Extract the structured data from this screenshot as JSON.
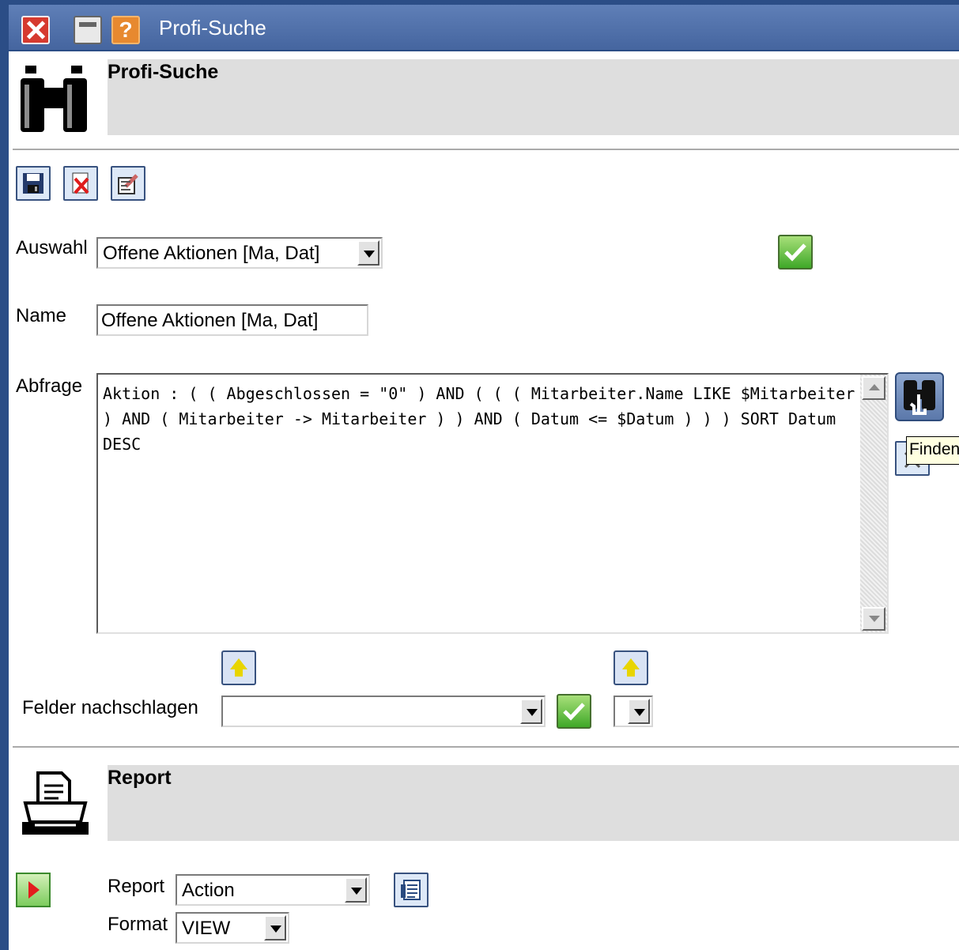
{
  "window": {
    "title": "Profi-Suche"
  },
  "search_section": {
    "heading": "Profi-Suche",
    "icon": "binoculars-icon"
  },
  "toolbar": {
    "save_icon": "save-icon",
    "delete_icon": "delete-icon",
    "edit_icon": "edit-icon"
  },
  "form": {
    "auswahl_label": "Auswahl",
    "auswahl_value": "Offene Aktionen [Ma, Dat]",
    "name_label": "Name",
    "name_value": "Offene Aktionen [Ma, Dat]",
    "abfrage_label": "Abfrage",
    "abfrage_value": "Aktion : ( ( Abgeschlossen = \"0\" ) AND ( ( ( Mitarbeiter.Name LIKE $Mitarbeiter ) AND ( Mitarbeiter -> Mitarbeiter ) ) AND ( Datum <= $Datum ) ) ) SORT Datum DESC",
    "find_tooltip": "Finden",
    "felder_label": "Felder nachschlagen",
    "felder_value": ""
  },
  "report_section": {
    "heading": "Report",
    "icon": "printer-icon",
    "report_label": "Report",
    "report_value": "Action",
    "format_label": "Format",
    "format_value": "VIEW"
  },
  "colors": {
    "titlebar": "#45659f",
    "section_background": "#dedede",
    "accept_green": "#3fa828"
  }
}
